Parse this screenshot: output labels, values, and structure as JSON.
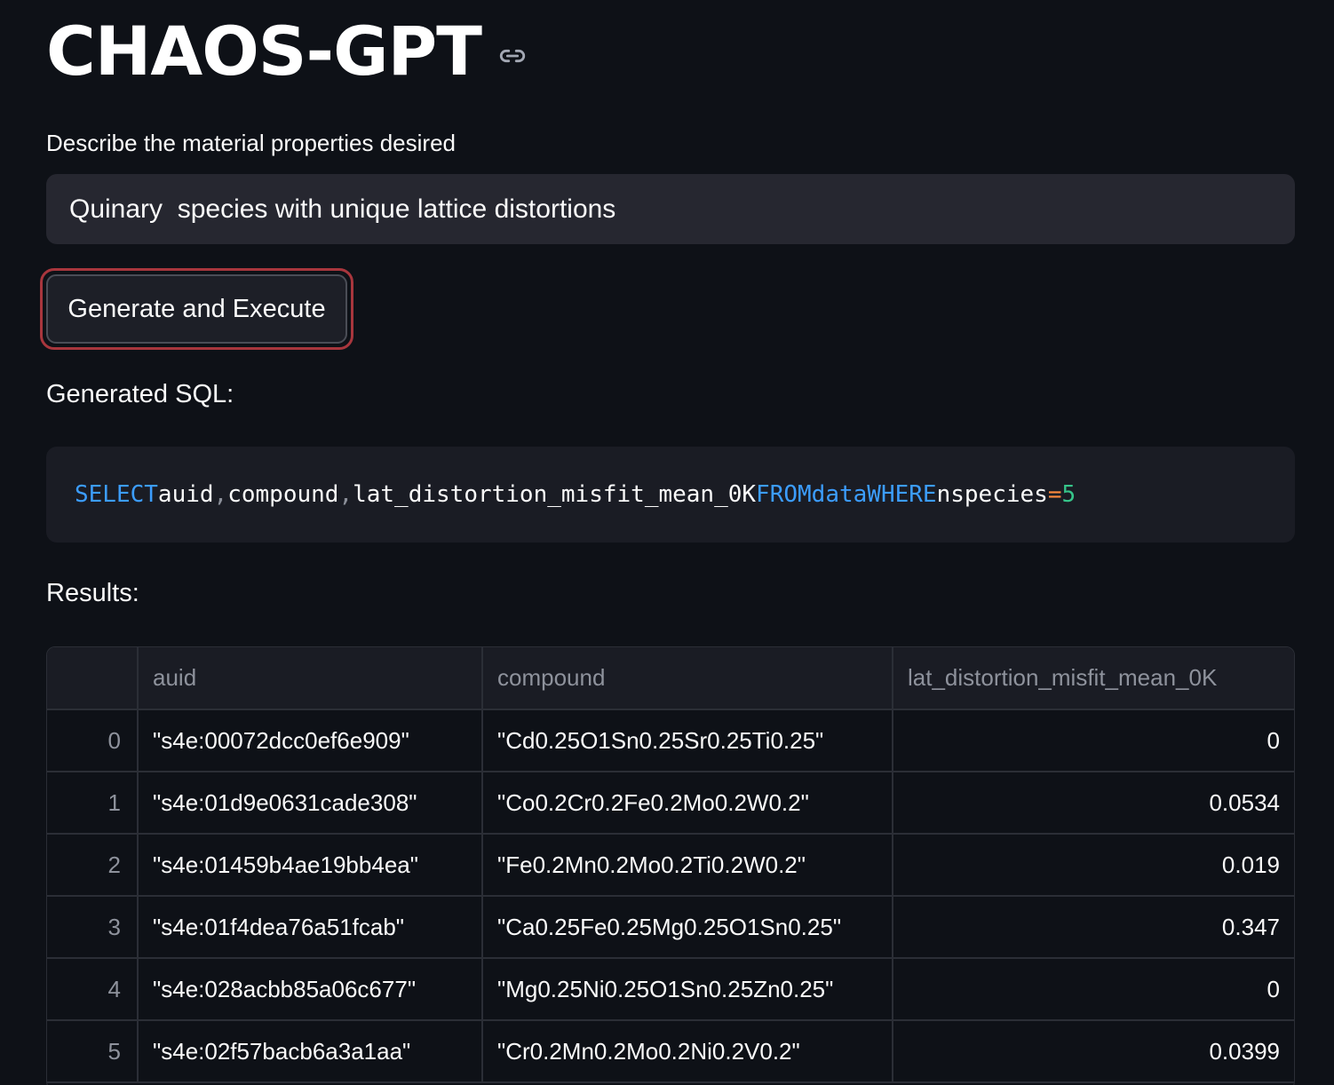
{
  "app": {
    "title": "CHAOS-GPT"
  },
  "input": {
    "label": "Describe the material properties desired",
    "value": "Quinary  species with unique lattice distortions"
  },
  "actions": {
    "generate_label": "Generate and Execute"
  },
  "sql_section": {
    "heading": "Generated SQL:",
    "tokens": {
      "select": "SELECT",
      "col1": "auid",
      "comma1": ",",
      "col2": "compound",
      "comma2": ",",
      "col3": "lat_distortion_misfit_mean_0K",
      "from": "FROM",
      "table": "data",
      "where": "WHERE",
      "field": "nspecies",
      "op": "=",
      "value": "5"
    }
  },
  "results": {
    "heading": "Results:",
    "columns": [
      "",
      "auid",
      "compound",
      "lat_distortion_misfit_mean_0K"
    ],
    "rows": [
      {
        "index": "0",
        "auid": "\"s4e:00072dcc0ef6e909\"",
        "compound": "\"Cd0.25O1Sn0.25Sr0.25Ti0.25\"",
        "misfit": "0"
      },
      {
        "index": "1",
        "auid": "\"s4e:01d9e0631cade308\"",
        "compound": "\"Co0.2Cr0.2Fe0.2Mo0.2W0.2\"",
        "misfit": "0.0534"
      },
      {
        "index": "2",
        "auid": "\"s4e:01459b4ae19bb4ea\"",
        "compound": "\"Fe0.2Mn0.2Mo0.2Ti0.2W0.2\"",
        "misfit": "0.019"
      },
      {
        "index": "3",
        "auid": "\"s4e:01f4dea76a51fcab\"",
        "compound": "\"Ca0.25Fe0.25Mg0.25O1Sn0.25\"",
        "misfit": "0.347"
      },
      {
        "index": "4",
        "auid": "\"s4e:028acbb85a06c677\"",
        "compound": "\"Mg0.25Ni0.25O1Sn0.25Zn0.25\"",
        "misfit": "0"
      },
      {
        "index": "5",
        "auid": "\"s4e:02f57bacb6a3a1aa\"",
        "compound": "\"Cr0.2Mn0.2Mo0.2Ni0.2V0.2\"",
        "misfit": "0.0399"
      }
    ]
  },
  "icons": {
    "title_anchor": "link-icon"
  },
  "colors": {
    "background": "#0e1117",
    "input_bg": "#262730",
    "focus_ring": "#a8363d",
    "sql_keyword": "#3c9dff",
    "sql_operator": "#ff8a3d",
    "sql_number": "#36c58a"
  }
}
